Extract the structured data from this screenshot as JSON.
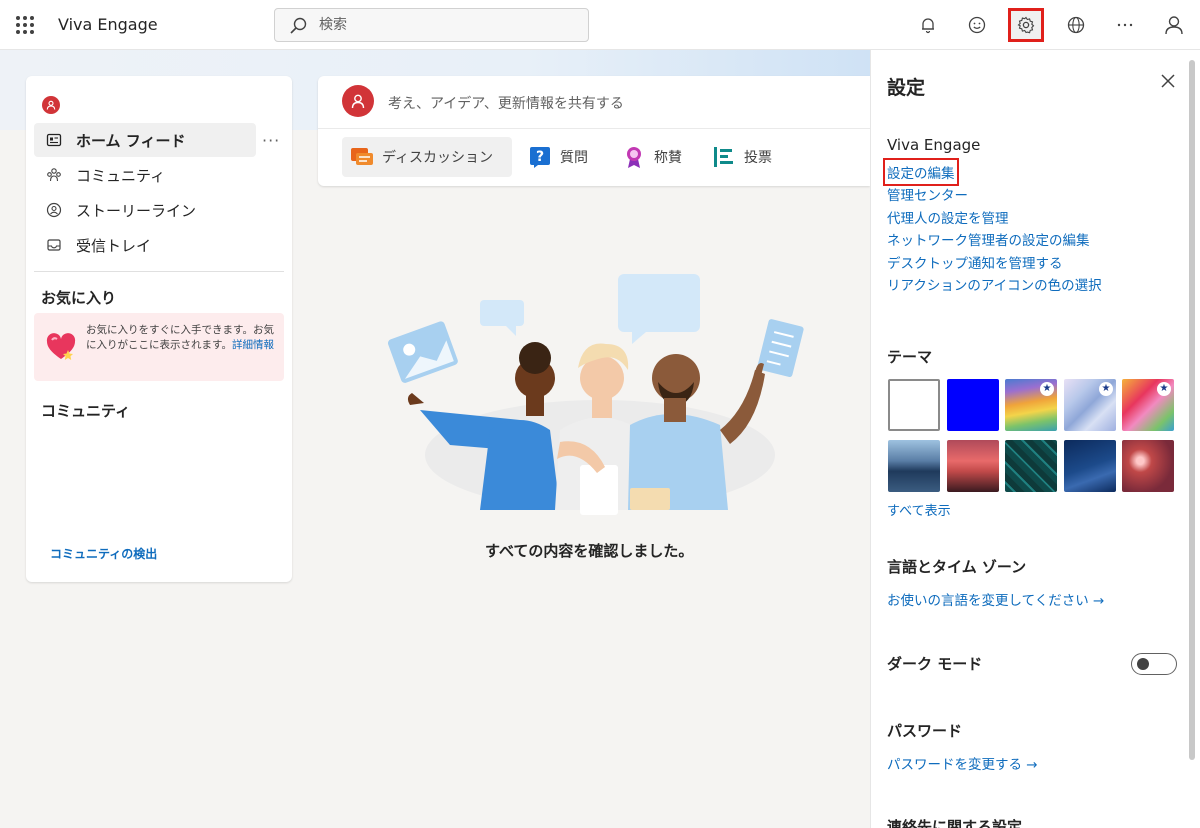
{
  "app": {
    "title": "Viva Engage"
  },
  "search": {
    "placeholder": "検索"
  },
  "toolbar": {
    "icons": [
      "bell-icon",
      "smiley-icon",
      "gear-icon",
      "globe-icon",
      "more-icon",
      "person-icon"
    ],
    "selected": "gear-icon"
  },
  "sidebar": {
    "nav": [
      {
        "label": "ホーム フィード",
        "icon": "home-feed-icon",
        "active": true
      },
      {
        "label": "コミュニティ",
        "icon": "community-icon"
      },
      {
        "label": "ストーリーライン",
        "icon": "storyline-icon"
      },
      {
        "label": "受信トレイ",
        "icon": "inbox-icon"
      }
    ],
    "more": "···",
    "favorites_title": "お気に入り",
    "favorites_msg": "お気に入りをすぐに入手できます。お気に入りがここに表示されます。",
    "favorites_link": "詳細情報",
    "communities_title": "コミュニティ",
    "discover": "コミュニティの検出"
  },
  "composer": {
    "placeholder": "考え、アイデア、更新情報を共有する",
    "tabs": [
      {
        "label": "ディスカッション",
        "icon": "discussion-icon",
        "active": true
      },
      {
        "label": "質問",
        "icon": "question-icon"
      },
      {
        "label": "称賛",
        "icon": "praise-icon"
      },
      {
        "label": "投票",
        "icon": "poll-icon"
      }
    ]
  },
  "feed": {
    "empty_message": "すべての内容を確認しました。"
  },
  "settings": {
    "title": "設定",
    "viva_title": "Viva Engage",
    "links": [
      "設定の編集",
      "管理センター",
      "代理人の設定を管理",
      "ネットワーク管理者の設定の編集",
      "デスクトップ通知を管理する",
      "リアクションのアイコンの色の選択"
    ],
    "theme_title": "テーマ",
    "show_all": "すべて表示",
    "lang_title": "言語とタイム ゾーン",
    "lang_link": "お使いの言語を変更してください →",
    "dark_title": "ダーク モード",
    "dark_mode": false,
    "password_title": "パスワード",
    "password_link": "パスワードを変更する →",
    "contact_title": "連絡先に関する設定"
  },
  "colors": {
    "accent": "#0f6cbd",
    "brand_red": "#d13438",
    "highlight": "#e0201b"
  }
}
